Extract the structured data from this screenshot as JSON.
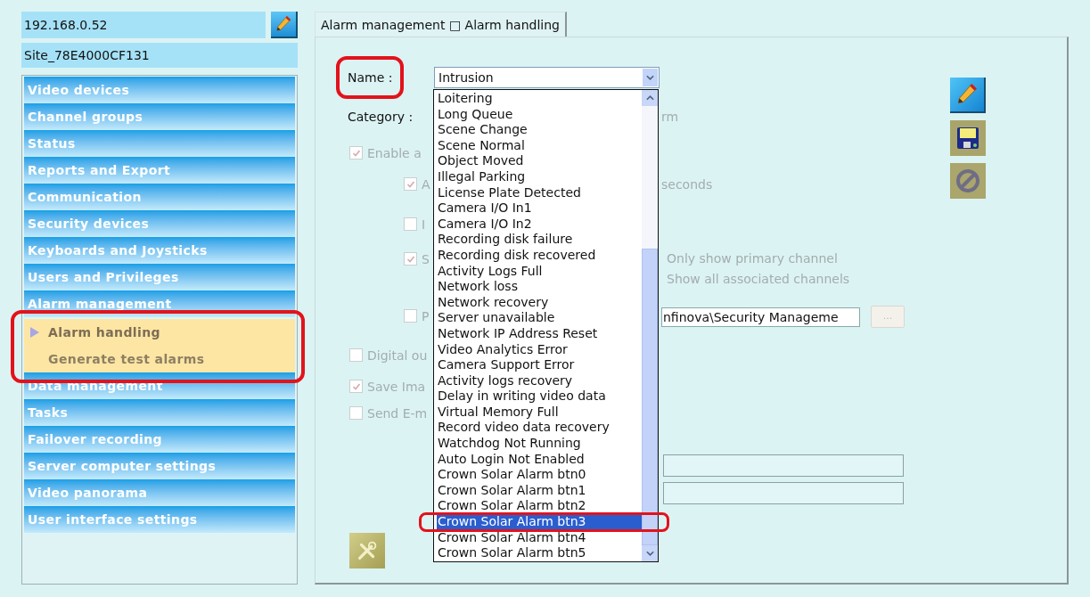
{
  "server": {
    "address": "192.168.0.52",
    "site": "Site_78E4000CF131"
  },
  "sidebar": {
    "items": [
      {
        "label": "Video devices"
      },
      {
        "label": "Channel groups"
      },
      {
        "label": "Status"
      },
      {
        "label": "Reports and Export"
      },
      {
        "label": "Communication"
      },
      {
        "label": "Security devices"
      },
      {
        "label": "Keyboards and Joysticks"
      },
      {
        "label": "Users and Privileges"
      },
      {
        "label": "Alarm management",
        "highlighted": true,
        "children": [
          {
            "label": "Alarm handling",
            "selected": true
          },
          {
            "label": "Generate test alarms",
            "selected": false
          }
        ]
      },
      {
        "label": "Data management"
      },
      {
        "label": "Tasks"
      },
      {
        "label": "Failover recording"
      },
      {
        "label": "Server computer settings"
      },
      {
        "label": "Video panorama"
      },
      {
        "label": "User interface settings"
      }
    ]
  },
  "tab": {
    "label": "Alarm management □ Alarm handling"
  },
  "form": {
    "name": {
      "label": "Name :",
      "value": "Intrusion",
      "highlighted": true
    },
    "category": {
      "label": "Category :",
      "value": "rm"
    },
    "options": [
      {
        "label": "Enable a",
        "checked": true,
        "children": [
          {
            "label": "A",
            "checked": true,
            "suffix": "seconds"
          },
          {
            "label": "I",
            "checked": false
          },
          {
            "label": "S",
            "checked": true,
            "choices": [
              "Only show primary channel",
              "Show all associated channels"
            ]
          },
          {
            "label": "P",
            "checked": false,
            "path": "nfinova\\Security Manageme",
            "browse": "..."
          }
        ]
      },
      {
        "label": "Digital ou",
        "checked": false
      },
      {
        "label": "Save Ima",
        "checked": true
      },
      {
        "label": "Send E-m",
        "checked": false
      }
    ]
  },
  "dropdown": {
    "options": [
      {
        "label": "Loitering",
        "selected": false
      },
      {
        "label": "Long Queue",
        "selected": false
      },
      {
        "label": "Scene Change",
        "selected": false
      },
      {
        "label": "Scene Normal",
        "selected": false
      },
      {
        "label": "Object Moved",
        "selected": false
      },
      {
        "label": "Illegal Parking",
        "selected": false
      },
      {
        "label": "License Plate Detected",
        "selected": false
      },
      {
        "label": "Camera I/O In1",
        "selected": false
      },
      {
        "label": "Camera I/O In2",
        "selected": false
      },
      {
        "label": "Recording disk failure",
        "selected": false
      },
      {
        "label": "Recording disk recovered",
        "selected": false
      },
      {
        "label": "Activity Logs Full",
        "selected": false
      },
      {
        "label": "Network loss",
        "selected": false
      },
      {
        "label": "Network recovery",
        "selected": false
      },
      {
        "label": "Server unavailable",
        "selected": false
      },
      {
        "label": "Network IP Address Reset",
        "selected": false
      },
      {
        "label": "Video Analytics Error",
        "selected": false
      },
      {
        "label": "Camera Support Error",
        "selected": false
      },
      {
        "label": "Activity logs recovery",
        "selected": false
      },
      {
        "label": "Delay in writing video data",
        "selected": false
      },
      {
        "label": "Virtual Memory Full",
        "selected": false
      },
      {
        "label": "Record video data recovery",
        "selected": false
      },
      {
        "label": "Watchdog Not Running",
        "selected": false
      },
      {
        "label": "Auto Login Not Enabled",
        "selected": false
      },
      {
        "label": "Crown Solar Alarm btn0",
        "selected": false
      },
      {
        "label": "Crown Solar Alarm btn1",
        "selected": false
      },
      {
        "label": "Crown Solar Alarm btn2",
        "selected": false
      },
      {
        "label": "Crown Solar Alarm btn3",
        "selected": true,
        "highlighted": true
      },
      {
        "label": "Crown Solar Alarm btn4",
        "selected": false
      },
      {
        "label": "Crown Solar Alarm btn5",
        "selected": false
      }
    ]
  }
}
